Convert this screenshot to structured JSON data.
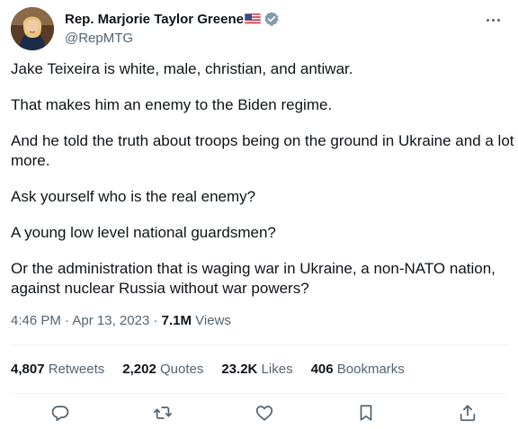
{
  "author": {
    "display_name": "Rep. Marjorie Taylor Greene",
    "handle": "@RepMTG",
    "flag_icon": "us-flag-icon",
    "verified_icon": "verified-badge-icon",
    "verified_color": "#829aab"
  },
  "tweet": {
    "paragraphs": [
      "Jake Teixeira is white, male, christian, and antiwar.",
      "That makes him an enemy to the Biden regime.",
      "And he told the truth about troops being on the ground in Ukraine and a lot more.",
      "Ask yourself who is the real enemy?",
      "A young low level national guardsmen?",
      "Or the administration that is waging war in Ukraine, a non-NATO nation, against nuclear Russia without war powers?"
    ],
    "time": "4:46 PM",
    "date": "Apr 13, 2023",
    "separator": "·",
    "views_count": "7.1M",
    "views_label": "Views"
  },
  "stats": {
    "retweets": {
      "count": "4,807",
      "label": "Retweets"
    },
    "quotes": {
      "count": "2,202",
      "label": "Quotes"
    },
    "likes": {
      "count": "23.2K",
      "label": "Likes"
    },
    "bookmarks": {
      "count": "406",
      "label": "Bookmarks"
    }
  },
  "actions": [
    "reply-icon",
    "retweet-icon",
    "like-icon",
    "bookmark-icon",
    "share-icon"
  ],
  "colors": {
    "text": "#0f1419",
    "secondary": "#536471",
    "divider": "#eff3f4",
    "background": "#ffffff"
  }
}
